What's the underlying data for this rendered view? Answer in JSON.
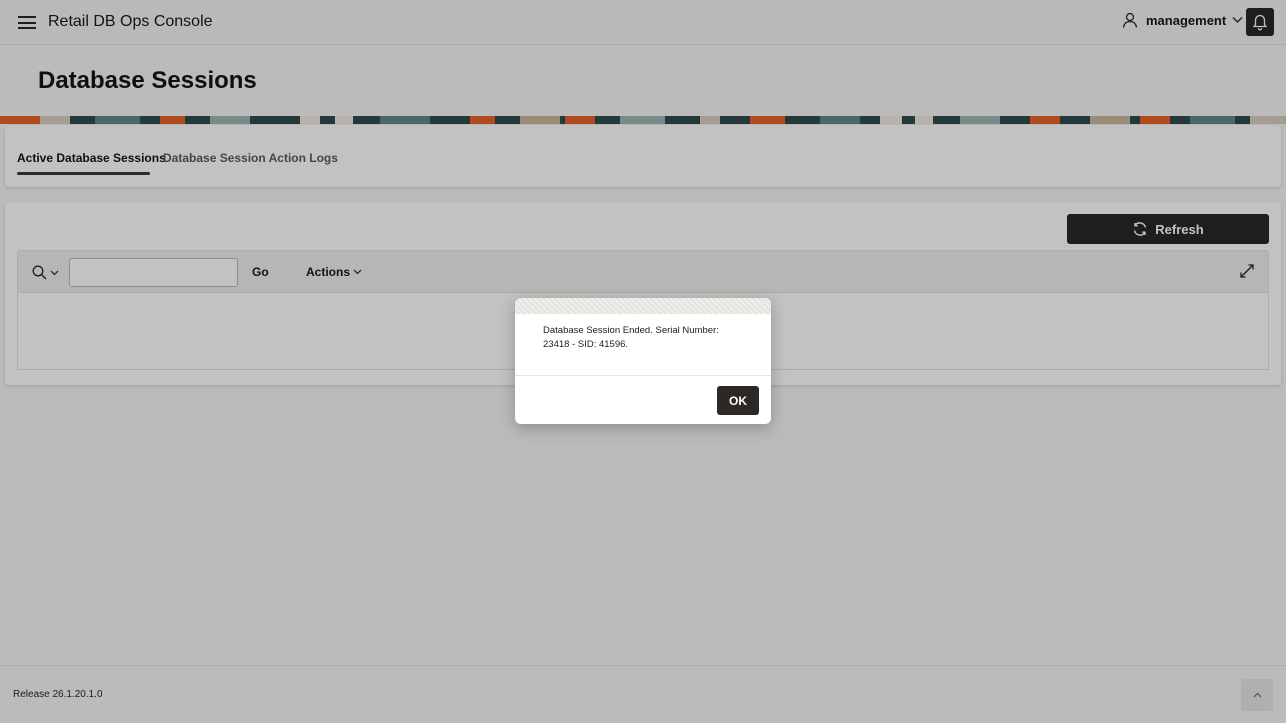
{
  "header": {
    "app_title": "Retail DB Ops Console",
    "username": "management",
    "icons": {
      "menu": "hamburger-icon",
      "user": "user-icon",
      "dropdown": "chevron-down-icon",
      "notifications": "bell-icon"
    }
  },
  "page": {
    "title": "Database Sessions"
  },
  "tabs": [
    {
      "label": "Active Database Sessions",
      "active": true
    },
    {
      "label": "Database Session Action Logs",
      "active": false
    }
  ],
  "report": {
    "refresh_label": "Refresh",
    "search_value": "",
    "go_label": "Go",
    "actions_label": "Actions",
    "icons": {
      "refresh": "refresh-icon",
      "search": "search-icon",
      "expand": "expand-icon"
    }
  },
  "dialog": {
    "message": "Database Session Ended. Serial Number: 23418 - SID: 41596.",
    "ok_label": "OK"
  },
  "footer": {
    "release": "Release 26.1.20.1.0"
  },
  "colors": {
    "dark_button": "#2b2826",
    "background": "#f7f6f4",
    "accent_orange": "#e8622a",
    "accent_teal": "#5f8a8b"
  }
}
